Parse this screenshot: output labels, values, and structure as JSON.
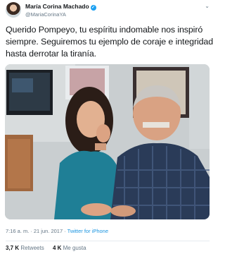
{
  "author": {
    "display_name": "María Corina Machado",
    "handle": "@MariaCorinaYA",
    "avatar": "profile-photo",
    "verified": true
  },
  "tweet": {
    "lines": [
      "Querido Pompeyo, tu espíritu indomable nos inspiró",
      "siempre. Seguiremos tu ejemplo de coraje e integridad",
      "hasta derrotar la tiranía."
    ]
  },
  "media": {
    "description_icon": "photo-two-people"
  },
  "meta": {
    "time": "7:16 a. m.",
    "separator": "·",
    "date": "21 jun. 2017",
    "source": "Twitter for iPhone"
  },
  "stats": {
    "retweets_count": "3,7 K",
    "retweets_label": "Retweets",
    "likes_count": "4 K",
    "likes_label": "Me gusta"
  },
  "colors": {
    "accent": "#1da1f2",
    "link": "#1b95e0",
    "muted": "#657786"
  }
}
